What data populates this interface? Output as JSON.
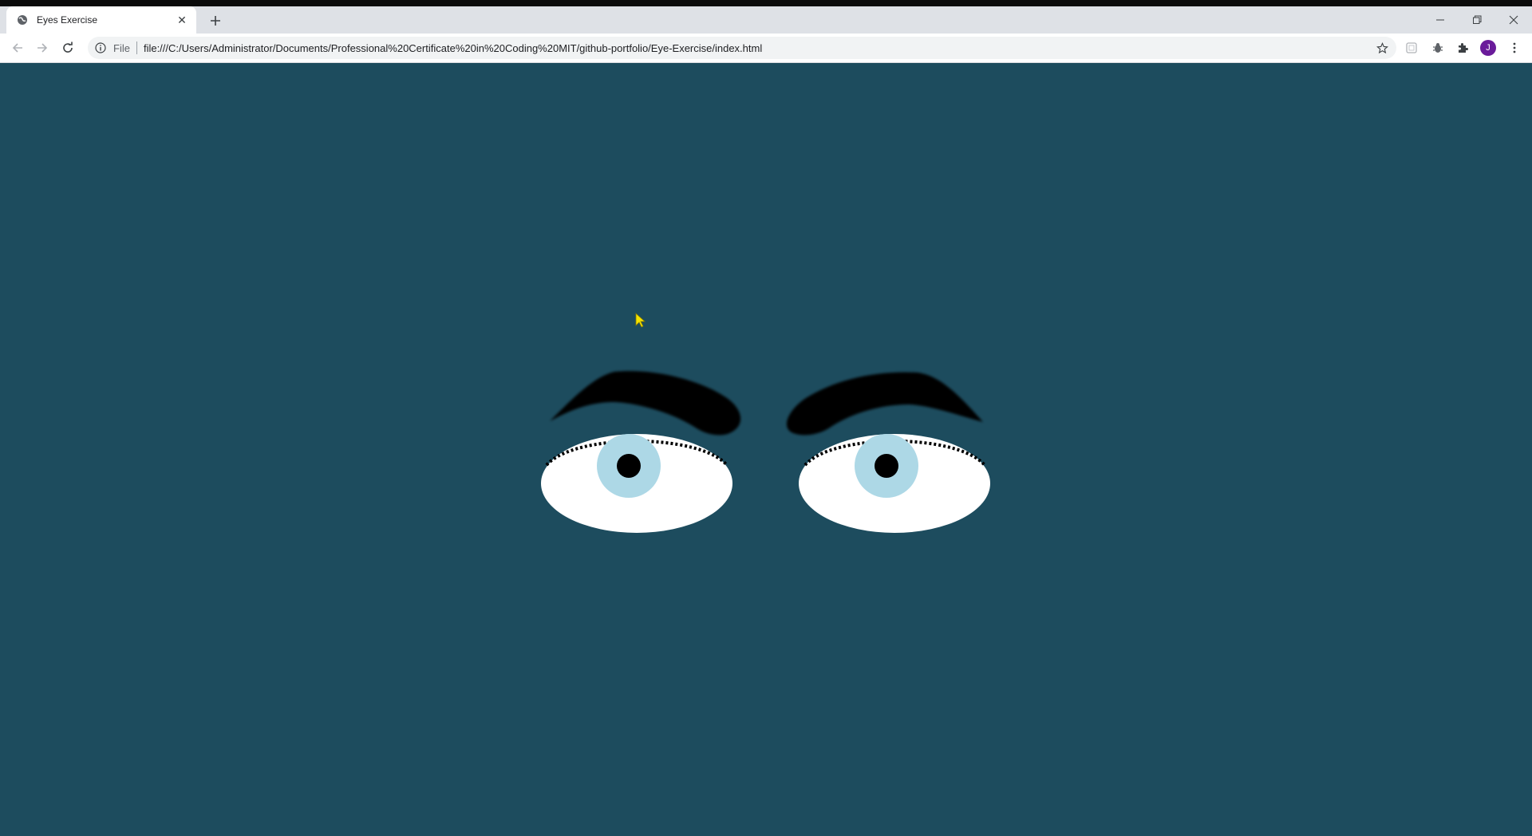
{
  "browser": {
    "tab": {
      "title": "Eyes Exercise",
      "favicon": "globe-icon",
      "close_icon": "close-icon"
    },
    "new_tab_icon": "plus-icon",
    "window_controls": [
      "minimize-icon",
      "restore-icon",
      "close-icon"
    ],
    "nav": {
      "back_icon": "arrow-left-icon",
      "forward_icon": "arrow-right-icon",
      "reload_icon": "reload-icon"
    },
    "address_bar": {
      "info_icon": "info-icon",
      "scheme_label": "File",
      "url": "file:///C:/Users/Administrator/Documents/Professional%20Certificate%20in%20Coding%20MIT/github-portfolio/Eye-Exercise/index.html",
      "bookmark_icon": "star-icon"
    },
    "extensions": [
      "extension-square-icon",
      "bug-extension-icon",
      "puzzle-icon"
    ],
    "profile_initial": "J",
    "menu_icon": "kebab-menu-icon"
  },
  "page": {
    "colors": {
      "background": "#1d4c5e",
      "eyebrow": "#000000",
      "sclera": "#ffffff",
      "iris": "#add8e6",
      "pupil": "#000000",
      "cursor": "#f4e400"
    }
  }
}
